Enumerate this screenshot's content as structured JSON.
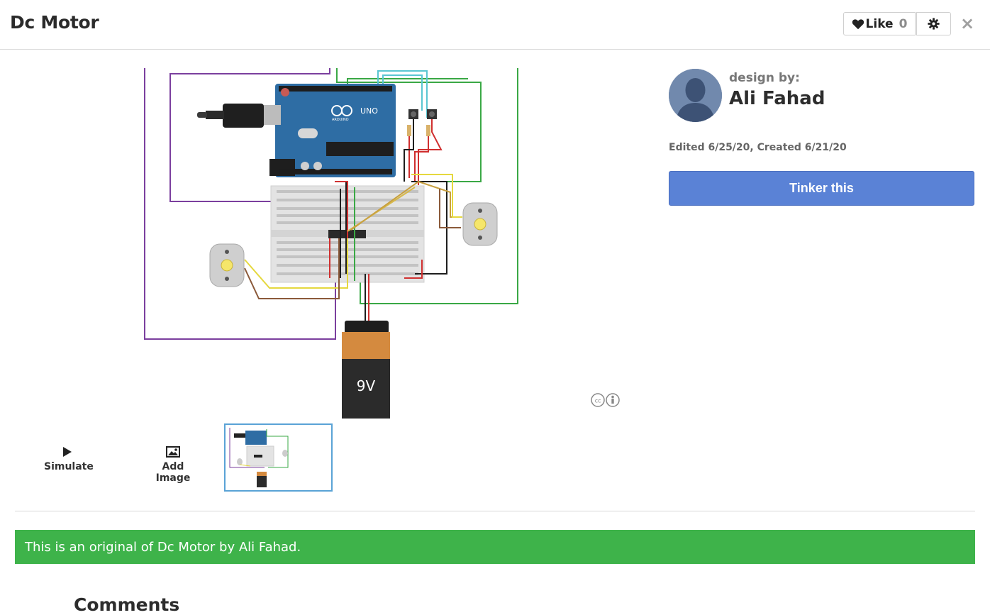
{
  "header": {
    "title": "Dc Motor",
    "like_label": "Like",
    "like_count": "0",
    "close_symbol": "×"
  },
  "author": {
    "design_by_label": "design by:",
    "name": "Ali Fahad",
    "dates": "Edited 6/25/20, Created 6/21/20"
  },
  "actions": {
    "tinker_label": "Tinker this",
    "simulate_label": "Simulate",
    "add_image_label": "Add Image"
  },
  "circuit": {
    "battery_label": "9V",
    "board_label": "UNO",
    "board_brand": "ARDUINO"
  },
  "banner": {
    "text": "This is an original of Dc Motor by Ali Fahad."
  },
  "comments": {
    "title": "Comments"
  },
  "colors": {
    "tinker_button": "#5a82d6",
    "banner_green": "#3eb34a",
    "thumbnail_border": "#5aa3d6"
  }
}
